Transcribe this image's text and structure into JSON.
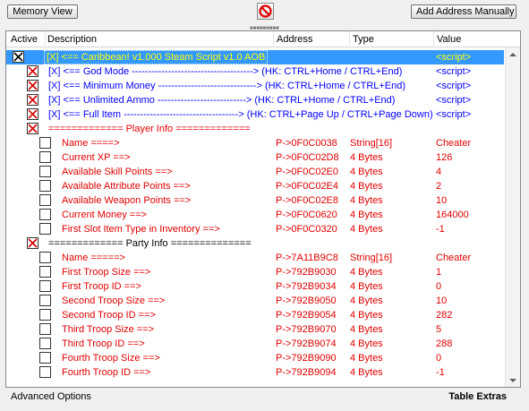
{
  "toolbar": {
    "memory_view_label": "Memory View",
    "add_address_label": "Add Address Manually"
  },
  "columns": {
    "active": "Active",
    "description": "Description",
    "address": "Address",
    "type": "Type",
    "value": "Value"
  },
  "rows": [
    {
      "desc": "[X] <== Caribbean! v1.000 Steam Script v1.0 AOB",
      "addr": "",
      "type": "",
      "value": "<script>"
    },
    {
      "desc": "[X] <== God Mode -------------------------------------> (HK: CTRL+Home / CTRL+End)",
      "addr": "",
      "type": "",
      "value": "<script>"
    },
    {
      "desc": "[X] <== Minimum Money ------------------------------> (HK: CTRL+Home / CTRL+End)",
      "addr": "",
      "type": "",
      "value": "<script>"
    },
    {
      "desc": "[X] <== Unlimited Ammo ---------------------------> (HK: CTRL+Home / CTRL+End)",
      "addr": "",
      "type": "",
      "value": "<script>"
    },
    {
      "desc": "[X] <== Full Item -----------------------------------> (HK: CTRL+Page Up / CTRL+Page Down)",
      "addr": "",
      "type": "",
      "value": "<script>"
    },
    {
      "desc": "============= Player Info =============",
      "addr": "",
      "type": "",
      "value": ""
    },
    {
      "desc": "Name ====>",
      "addr": "P->0F0C0038",
      "type": "String[16]",
      "value": "Cheater"
    },
    {
      "desc": "Current XP ==>",
      "addr": "P->0F0C02D8",
      "type": "4 Bytes",
      "value": "126"
    },
    {
      "desc": "Available Skill Points  ==>",
      "addr": "P->0F0C02E0",
      "type": "4 Bytes",
      "value": "4"
    },
    {
      "desc": "Available Attribute Points  ==>",
      "addr": "P->0F0C02E4",
      "type": "4 Bytes",
      "value": "2"
    },
    {
      "desc": "Available Weapon Points  ==>",
      "addr": "P->0F0C02E8",
      "type": "4 Bytes",
      "value": "10"
    },
    {
      "desc": "Current Money ==>",
      "addr": "P->0F0C0620",
      "type": "4 Bytes",
      "value": "164000"
    },
    {
      "desc": "First Slot Item Type  in Inventory ==>",
      "addr": "P->0F0C0320",
      "type": "4 Bytes",
      "value": "-1"
    },
    {
      "desc": "============= Party Info ==============",
      "addr": "",
      "type": "",
      "value": ""
    },
    {
      "desc": "Name =====>",
      "addr": "P->7A11B9C8",
      "type": "String[16]",
      "value": "Cheater"
    },
    {
      "desc": "First Troop Size ==>",
      "addr": "P->792B9030",
      "type": "4 Bytes",
      "value": "1"
    },
    {
      "desc": "First Troop ID ==>",
      "addr": "P->792B9034",
      "type": "4 Bytes",
      "value": "0"
    },
    {
      "desc": "Second Troop Size ==>",
      "addr": "P->792B9050",
      "type": "4 Bytes",
      "value": "10"
    },
    {
      "desc": "Second Troop ID ==>",
      "addr": "P->792B9054",
      "type": "4 Bytes",
      "value": "282"
    },
    {
      "desc": "Third Troop Size ==>",
      "addr": "P->792B9070",
      "type": "4 Bytes",
      "value": "5"
    },
    {
      "desc": "Third Troop ID ==>",
      "addr": "P->792B9074",
      "type": "4 Bytes",
      "value": "288"
    },
    {
      "desc": "Fourth Troop Size ==>",
      "addr": "P->792B9090",
      "type": "4 Bytes",
      "value": "0"
    },
    {
      "desc": "Fourth Troop ID ==>",
      "addr": "P->792B9094",
      "type": "4 Bytes",
      "value": "-1"
    }
  ],
  "footer": {
    "advanced_options": "Advanced Options",
    "table_extras": "Table Extras"
  },
  "icons": {
    "stop": "stop-icon",
    "checkbox_checked": "x-checkbox-icon"
  },
  "colors": {
    "selection": "#3399ff",
    "script_text": "#0000ff",
    "entry_text": "#e00000",
    "selected_text": "#ffff00"
  }
}
